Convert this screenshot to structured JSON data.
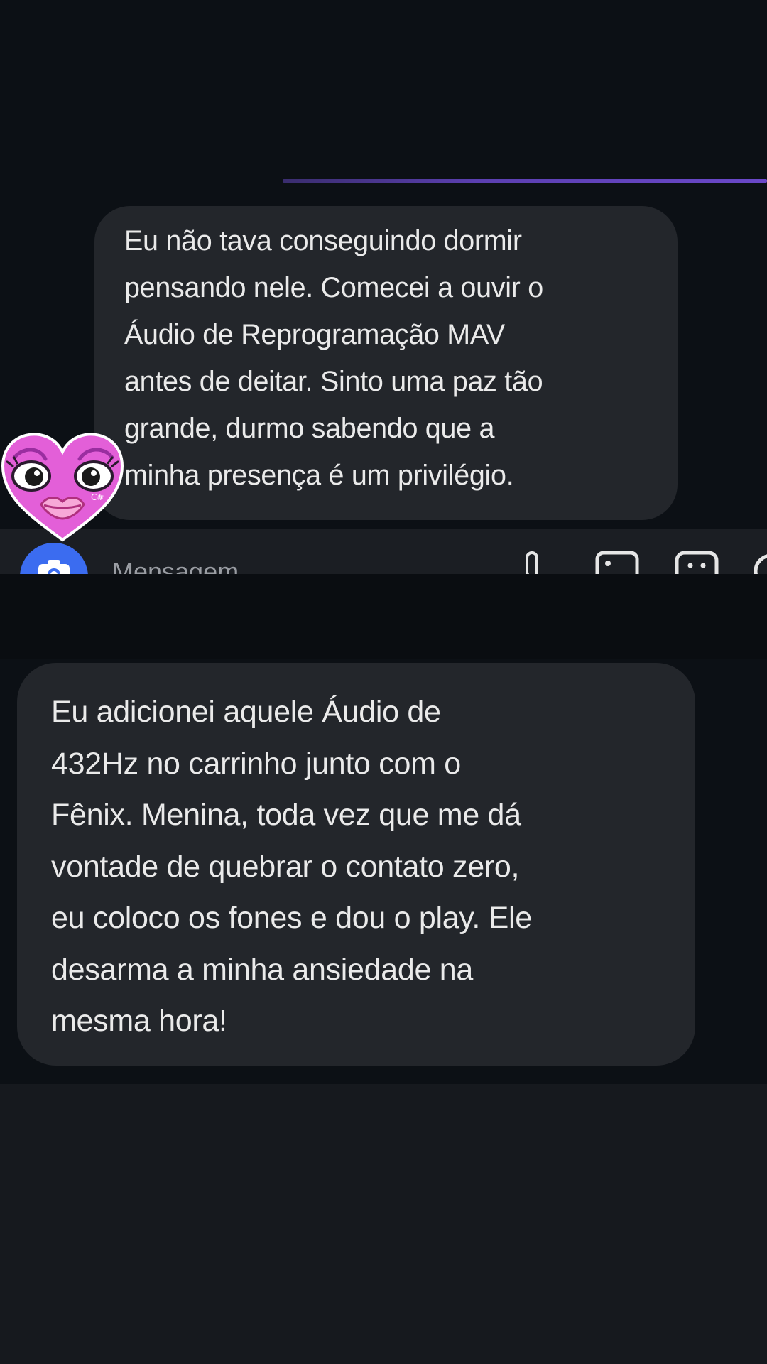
{
  "messages": [
    {
      "lines": [
        "Eu não tava conseguindo dormir",
        "pensando nele. Comecei a ouvir o",
        "Áudio de Reprogramação MAV",
        "antes de deitar. Sinto uma paz tão",
        "grande, durmo sabendo que a",
        "minha presença é um privilégio."
      ]
    },
    {
      "lines": [
        "Eu adicionei aquele Áudio de",
        "432Hz no carrinho junto com o",
        "Fênix. Menina, toda vez que me dá",
        "vontade de quebrar o contato zero,",
        "eu coloco os fones e dou o play. Ele",
        "desarma a minha ansiedade na",
        "mesma hora!"
      ]
    }
  ],
  "input_bar": {
    "placeholder": "Mensagem",
    "icons": [
      "camera-icon",
      "microphone-icon",
      "image-icon",
      "sticker-icon",
      "add-icon"
    ]
  },
  "sticker": {
    "name": "heart-face-sticker",
    "signature": "C#"
  },
  "colors": {
    "background": "#0c1015",
    "bubble": "#23262b",
    "text": "#eaeaea",
    "accent_line": "#6a48c8",
    "camera_button": "#3b6cf0",
    "sticker_pink": "#e35fd8"
  }
}
